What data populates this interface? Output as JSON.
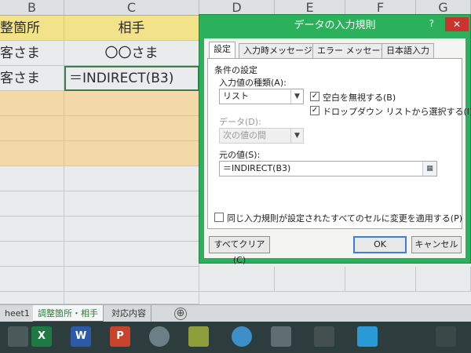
{
  "sheet": {
    "columns": [
      "B",
      "C",
      "D",
      "E",
      "F",
      "G"
    ],
    "cells": {
      "b1": "整箇所",
      "c1": "相手",
      "b2": "客さま",
      "c2": "〇〇さま",
      "b3": "客さま",
      "c3": "＝INDIRECT(B3)"
    },
    "tabs": [
      "heet1",
      "調整箇所・相手",
      "対応内容"
    ],
    "add_sheet": "⊕"
  },
  "dialog": {
    "title": "データの入力規則",
    "help": "?",
    "close": "✕",
    "tabs": [
      "設定",
      "入力時メッセージ",
      "エラー メッセージ",
      "日本語入力"
    ],
    "section_title": "条件の設定",
    "type_label": "入力値の種類(A):",
    "type_value": "リスト",
    "ignore_blank_label": "空白を無視する(B)",
    "dropdown_label": "ドロップダウン リストから選択する(I)",
    "data_label": "データ(D):",
    "data_value": "次の値の間",
    "source_label": "元の値(S):",
    "source_value": "＝INDIRECT(B3)",
    "apply_all_label": "同じ入力規則が設定されたすべてのセルに変更を適用する(P)",
    "clear_all_button": "すべてクリア(C)",
    "ok_button": "OK",
    "cancel_button": "キャンセル"
  },
  "taskbar": {
    "apps": [
      "X",
      "W",
      "P"
    ]
  },
  "colors": {
    "dialog_frame": "#2bb15b",
    "header_yellow": "#f2e38a",
    "row_orange": "#f3d9a7"
  }
}
